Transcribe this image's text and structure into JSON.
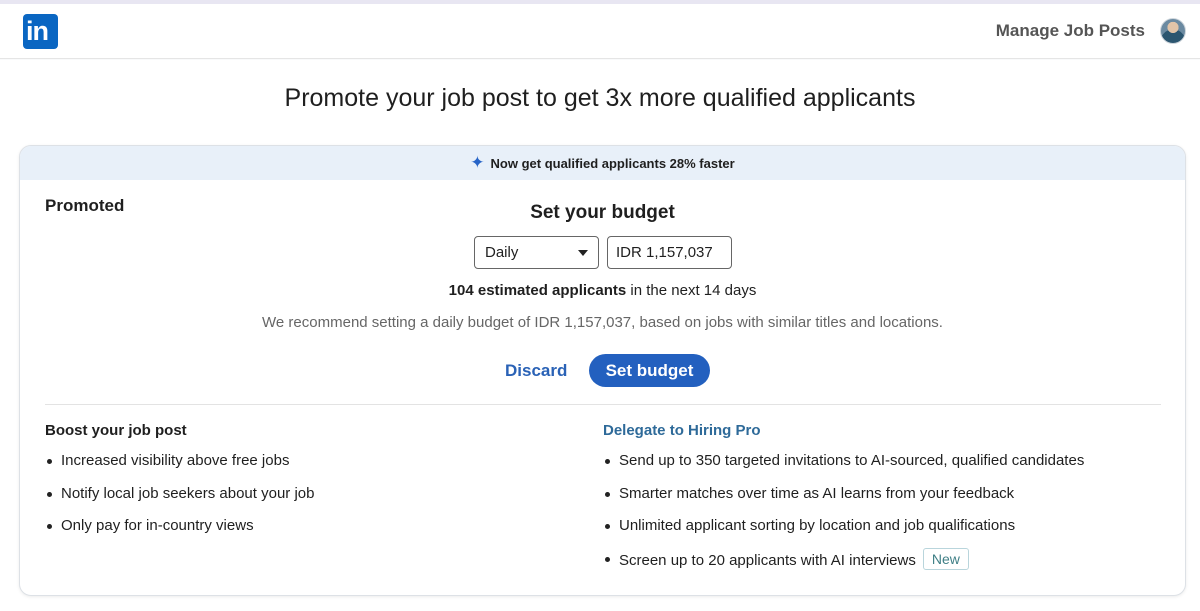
{
  "header": {
    "logo_text": "in",
    "manage_label": "Manage Job Posts"
  },
  "page": {
    "title": "Promote your job post to get 3x more qualified applicants"
  },
  "card": {
    "banner_text": "Now get qualified applicants 28% faster",
    "promoted_label": "Promoted",
    "budget_title": "Set your budget",
    "budget_type": "Daily",
    "budget_amount": "IDR 1,157,037",
    "estimate_bold": "104 estimated applicants",
    "estimate_rest": " in the next 14 days",
    "recommendation": "We recommend setting a daily budget of IDR 1,157,037, based on jobs with similar titles and locations.",
    "discard_label": "Discard",
    "set_budget_label": "Set budget"
  },
  "boost": {
    "title": "Boost your job post",
    "items": [
      "Increased visibility above free jobs",
      "Notify local job seekers about your job",
      "Only pay for in-country views"
    ]
  },
  "delegate": {
    "title": "Delegate to Hiring Pro",
    "items": [
      "Send up to 350 targeted invitations to AI-sourced, qualified candidates",
      "Smarter matches over time as AI learns from your feedback",
      "Unlimited applicant sorting by location and job qualifications",
      "Screen up to 20 applicants with AI interviews"
    ],
    "new_badge": "New"
  },
  "icons": {
    "logo": "linkedin-logo",
    "banner": "sparkle-icon",
    "select": "chevron-down-icon",
    "avatar": "user-avatar"
  },
  "colors": {
    "brand": "#0a66c2",
    "primary_button": "#2360bf",
    "link": "#2a62b6",
    "banner_bg": "#e8f0f9"
  }
}
